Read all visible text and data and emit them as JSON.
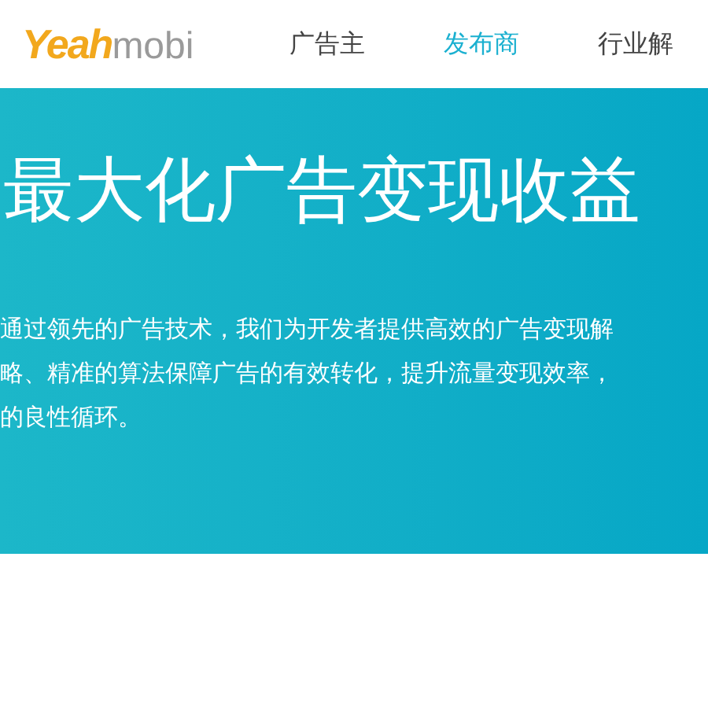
{
  "header": {
    "logo": {
      "accent": "Yeah",
      "rest": "mobi"
    },
    "nav": [
      {
        "label": "广告主",
        "selected": false
      },
      {
        "label": "发布商",
        "selected": true
      },
      {
        "label": "行业解",
        "selected": false
      }
    ]
  },
  "hero": {
    "title": "最大化广告变现收益",
    "lines": [
      "通过领先的广告技术，我们为开发者提供高效的广告变现解",
      "略、精准的算法保障广告的有效转化，提升流量变现效率，",
      "的良性循环。"
    ]
  }
}
